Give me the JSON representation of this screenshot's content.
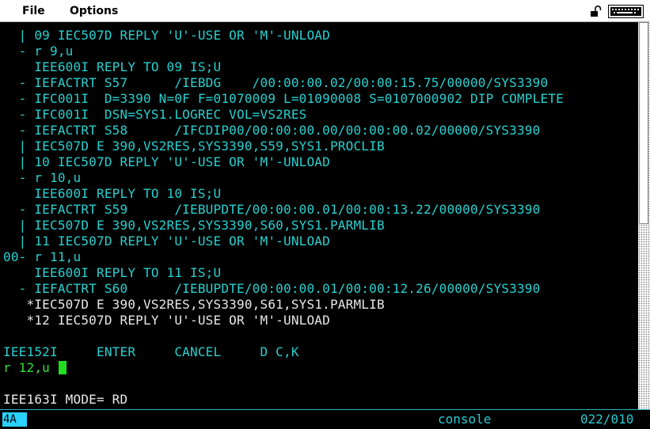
{
  "menubar": {
    "file_label": "File",
    "options_label": "Options",
    "icons": [
      "lock-icon",
      "keyboard-icon"
    ]
  },
  "terminal": {
    "lines": [
      {
        "text": "  | 09 IEC507D REPLY 'U'-USE OR 'M'-UNLOAD",
        "color": "cyan"
      },
      {
        "text": "  - r 9,u",
        "color": "cyan"
      },
      {
        "text": "    IEE600I REPLY TO 09 IS;U",
        "color": "cyan"
      },
      {
        "text": "  - IEFACTRT S57      /IEBDG    /00:00:00.02/00:00:15.75/00000/SYS3390",
        "color": "cyan"
      },
      {
        "text": "  - IFC001I  D=3390 N=0F F=01070009 L=01090008 S=0107000902 DIP COMPLETE",
        "color": "cyan"
      },
      {
        "text": "  - IFC001I  DSN=SYS1.LOGREC VOL=VS2RES",
        "color": "cyan"
      },
      {
        "text": "  - IEFACTRT S58      /IFCDIP00/00:00:00.00/00:00:00.02/00000/SYS3390",
        "color": "cyan"
      },
      {
        "text": "  | IEC507D E 390,VS2RES,SYS3390,S59,SYS1.PROCLIB",
        "color": "cyan"
      },
      {
        "text": "  | 10 IEC507D REPLY 'U'-USE OR 'M'-UNLOAD",
        "color": "cyan"
      },
      {
        "text": "  - r 10,u",
        "color": "cyan"
      },
      {
        "text": "    IEE600I REPLY TO 10 IS;U",
        "color": "cyan"
      },
      {
        "text": "  - IEFACTRT S59      /IEBUPDTE/00:00:00.01/00:00:13.22/00000/SYS3390",
        "color": "cyan"
      },
      {
        "text": "  | IEC507D E 390,VS2RES,SYS3390,S60,SYS1.PARMLIB",
        "color": "cyan"
      },
      {
        "text": "  | 11 IEC507D REPLY 'U'-USE OR 'M'-UNLOAD",
        "color": "cyan"
      },
      {
        "text": "00- r 11,u",
        "color": "cyan"
      },
      {
        "text": "    IEE600I REPLY TO 11 IS;U",
        "color": "cyan"
      },
      {
        "text": "  - IEFACTRT S60      /IEBUPDTE/00:00:00.01/00:00:12.26/00000/SYS3390",
        "color": "cyan"
      },
      {
        "text": "   *IEC507D E 390,VS2RES,SYS3390,S61,SYS1.PARMLIB",
        "color": "white"
      },
      {
        "text": "   *12 IEC507D REPLY 'U'-USE OR 'M'-UNLOAD",
        "color": "white"
      },
      {
        "text": "",
        "color": "cyan"
      },
      {
        "text": "IEE152I     ENTER     CANCEL     D C,K",
        "color": "cyan"
      },
      {
        "text": "r 12,u ",
        "color": "green"
      },
      {
        "text": "",
        "color": "cyan"
      },
      {
        "text": "IEE163I MODE= RD",
        "color": "white"
      }
    ]
  },
  "statusbar": {
    "indicator": "4A",
    "mode": "console",
    "position": "022/010"
  },
  "colors": {
    "background": "#000000",
    "cyan_text": "#28d0d0",
    "white_text": "#e8e8e8",
    "green_text": "#2ee02e",
    "indicator_bg": "#2ad2ff"
  }
}
